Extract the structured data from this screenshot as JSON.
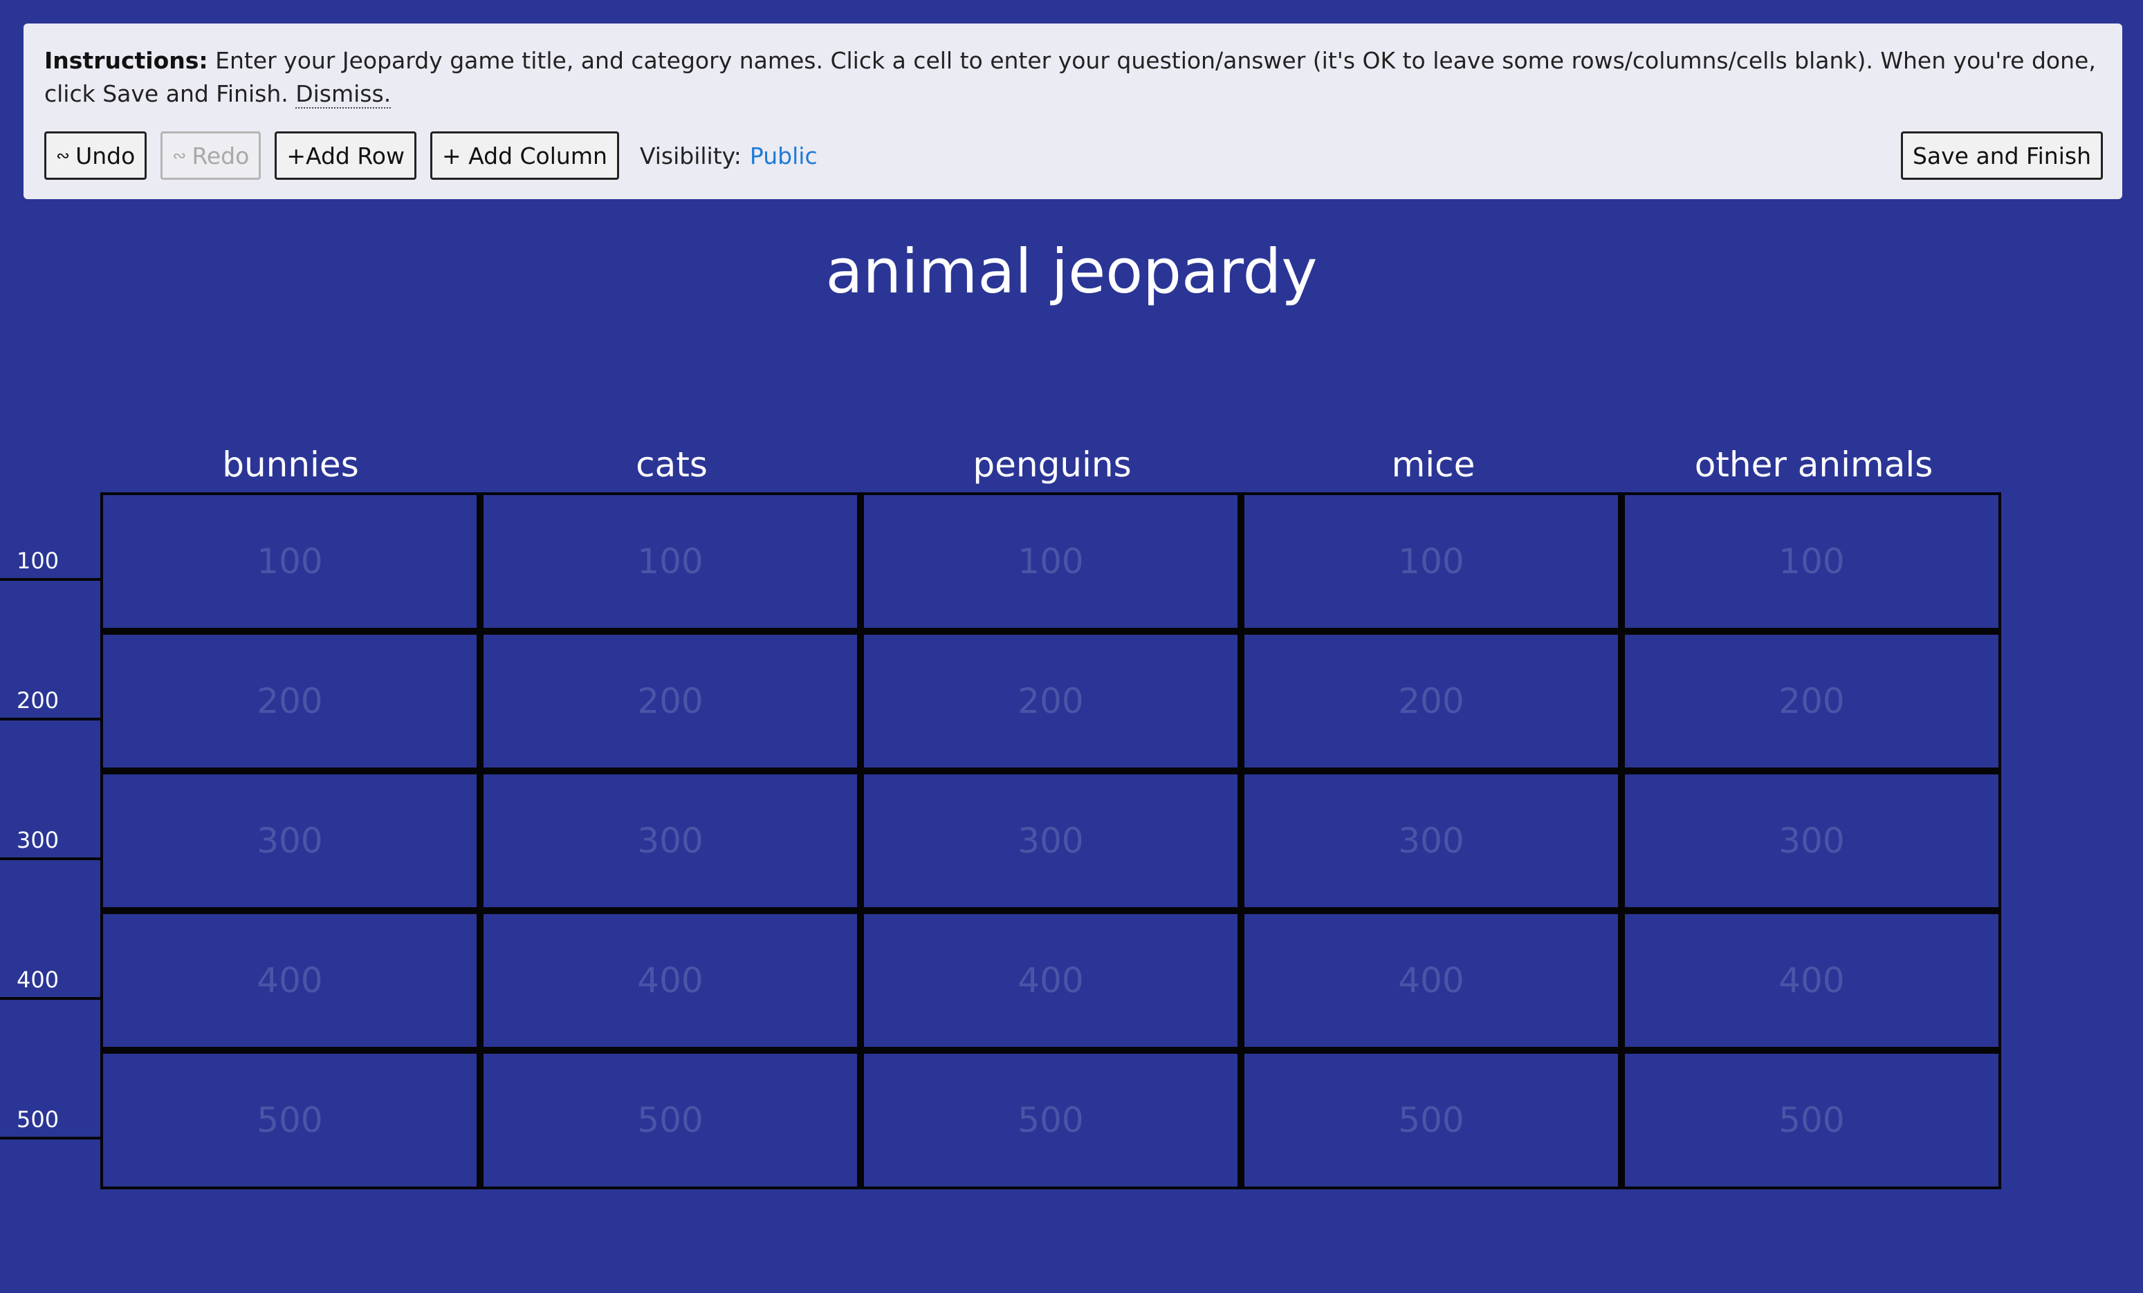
{
  "instructions": {
    "heading": "Instructions:",
    "text": " Enter your Jeopardy game title, and category names. Click a cell to enter your question/answer (it's OK to leave some rows/columns/cells blank). When you're done, click Save and Finish. ",
    "dismiss": "Dismiss."
  },
  "toolbar": {
    "undo": "Undo",
    "redo": "Redo",
    "add_row": "+Add Row",
    "add_column": "+ Add Column",
    "visibility_label": "Visibility:",
    "visibility_value": "Public",
    "save": "Save and Finish"
  },
  "game": {
    "title": "animal jeopardy",
    "categories": [
      "bunnies",
      "cats",
      "penguins",
      "mice",
      "other animals"
    ],
    "row_values": [
      "100",
      "200",
      "300",
      "400",
      "500"
    ]
  },
  "colors": {
    "background": "#2b3595",
    "panel": "#ebebf3",
    "link": "#1e7ad6",
    "cell_text": "#4a55a8"
  }
}
